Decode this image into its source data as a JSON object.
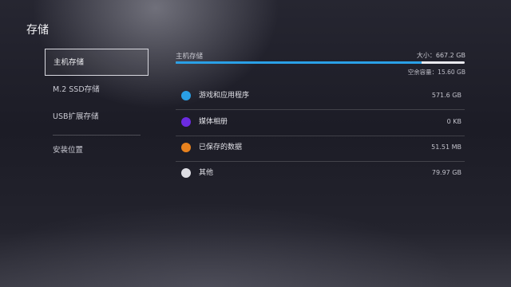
{
  "page": {
    "title": "存储"
  },
  "sidebar": {
    "items": [
      {
        "label": "主机存储",
        "active": true
      },
      {
        "label": "M.2 SSD存储",
        "active": false
      },
      {
        "label": "USB扩展存储",
        "active": false
      },
      {
        "label": "安装位置",
        "active": false
      }
    ]
  },
  "storage": {
    "label": "主机存储",
    "total": "大小：667.2 GB",
    "free": "空余容量：15.60 GB",
    "used_fraction": 0.85,
    "colors": {
      "used": "#2aa0e6",
      "free": "#e9e9ee"
    }
  },
  "categories": [
    {
      "name": "游戏和应用程序",
      "size": "571.6 GB",
      "color": "#2aa0e6",
      "icon": "circle-icon"
    },
    {
      "name": "媒体相册",
      "size": "0 KB",
      "color": "#6b2be0",
      "icon": "circle-icon"
    },
    {
      "name": "已保存的数据",
      "size": "51.51 MB",
      "color": "#e8821e",
      "icon": "circle-icon"
    },
    {
      "name": "其他",
      "size": "79.97 GB",
      "color": "#dedee4",
      "icon": "circle-icon"
    }
  ]
}
